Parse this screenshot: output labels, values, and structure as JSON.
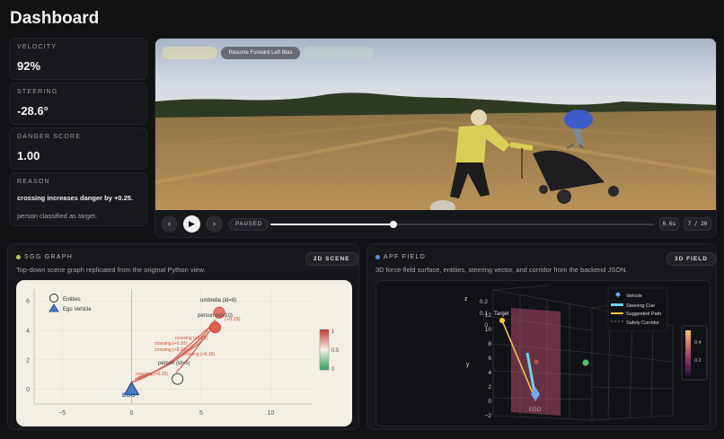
{
  "title": "Dashboard",
  "metrics": {
    "velocity": {
      "label": "VELOCITY",
      "value": "92%"
    },
    "steering": {
      "label": "STEERING",
      "value": "-28.6°"
    },
    "danger": {
      "label": "DANGER SCORE",
      "value": "1.00"
    },
    "reason": {
      "label": "REASON",
      "primary": "crossing increases danger by +0.25.",
      "secondary": "person classified as target."
    }
  },
  "video": {
    "action_pill": "Resume Forward Left Bias",
    "status": "PAUSED",
    "time": "0.6s",
    "frame": "7 / 20",
    "progress": 0.32,
    "controls": {
      "prev": "‹",
      "play": "▶",
      "next": "›"
    },
    "colors": {
      "sky": "#c9d2de",
      "field": "#b08a52",
      "trees": "#2f3a22",
      "jacket": "#dfd35a",
      "umbrella": "#3b5cc9"
    }
  },
  "sgg": {
    "title": "SGG GRAPH",
    "description": "Top-down scene graph replicated from the original Python view.",
    "button": "2D SCENE",
    "dot_color": "#b8c45a",
    "legend": {
      "entities": "Entities",
      "vehicle": "Ego Vehicle"
    },
    "x_ticks": [
      "−5",
      "0",
      "5",
      "10"
    ],
    "y_ticks": [
      "6",
      "4",
      "2",
      "0"
    ],
    "colorbar_ticks": [
      "1",
      "0.5",
      "0"
    ],
    "labels": {
      "umbrella": "umbrella (id=8)",
      "person_top": "person (id=10)",
      "person_top_score": "(+0.15)",
      "person_low": "person (id=5)",
      "ego": "EGO",
      "c1": "crossing (+0.25)",
      "c2": "crossing (+0.10)",
      "c3": "crossing (+0.10)",
      "c4": "crossing (+0.10)",
      "c5": "crossing (+0.10)"
    }
  },
  "chart_data": {
    "type": "scatter",
    "x_ticks": [
      -5,
      0,
      5,
      10
    ],
    "y_ticks": [
      0,
      2,
      4,
      6
    ],
    "xlim": [
      -7,
      13
    ],
    "ylim": [
      -1,
      6.8
    ],
    "entities": [
      {
        "name": "umbrella (id=8)",
        "x": 6.3,
        "y": 5.2
      },
      {
        "name": "person (id=10)",
        "x": 6.0,
        "y": 4.2
      },
      {
        "name": "person (id=5)",
        "x": 3.3,
        "y": 0.7
      }
    ],
    "ego": {
      "x": 0,
      "y": 0
    },
    "colorbar": [
      0,
      1
    ]
  },
  "apf": {
    "title": "APF FIELD",
    "description": "3D force-field surface, entities, steering vector, and corridor from the backend JSON.",
    "button": "3D FIELD",
    "dot_color": "#5b8fd6",
    "legend": {
      "vehicle": "Vehicle",
      "steering": "Steering Cue",
      "path": "Suggested Path",
      "corridor": "Safety Corridor"
    },
    "target_label": "Target",
    "ego_label": "EGO",
    "y_axis_label": "y",
    "z_axis_label": "z",
    "y_ticks": [
      "12",
      "10",
      "8",
      "6",
      "4",
      "2",
      "0",
      "−2"
    ],
    "z_ticks": [
      "0.2",
      "0.1",
      "0"
    ],
    "colorbar_ticks": [
      "0.4",
      "0.2"
    ]
  }
}
